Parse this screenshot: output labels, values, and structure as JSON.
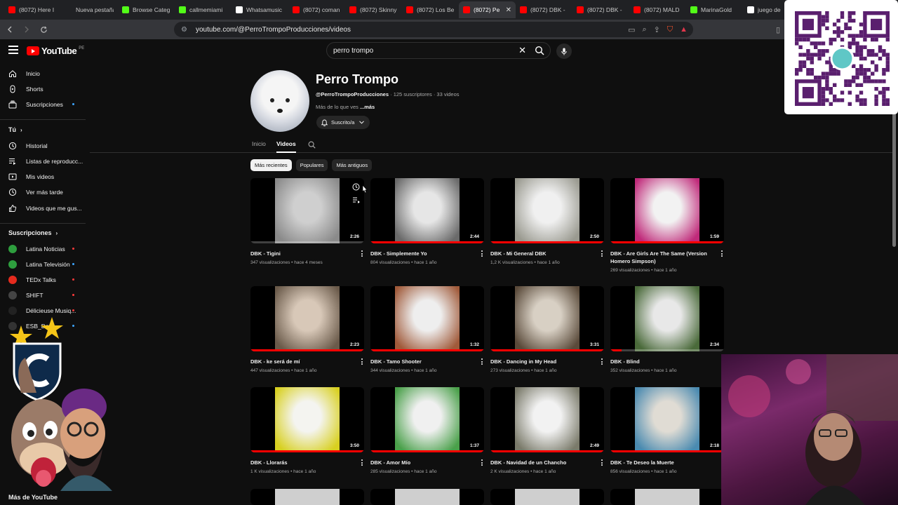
{
  "browser": {
    "tabs": [
      {
        "title": "(8072) Here I",
        "favicon": "youtube",
        "active": false
      },
      {
        "title": "Nueva pestaña",
        "favicon": "blank",
        "active": false
      },
      {
        "title": "Browse Categ",
        "favicon": "kick",
        "active": false
      },
      {
        "title": "callmemiami",
        "favicon": "kick",
        "active": false
      },
      {
        "title": "Whatsamusic",
        "favicon": "music",
        "active": false
      },
      {
        "title": "(8072) coman",
        "favicon": "youtube",
        "active": false
      },
      {
        "title": "(8072) Skinny",
        "favicon": "youtube",
        "active": false
      },
      {
        "title": "(8072) Los Be",
        "favicon": "youtube",
        "active": false
      },
      {
        "title": "(8072) Pe",
        "favicon": "youtube",
        "active": true
      },
      {
        "title": "(8072) DBK -",
        "favicon": "youtube",
        "active": false
      },
      {
        "title": "(8072) DBK -",
        "favicon": "youtube",
        "active": false
      },
      {
        "title": "(8072) MALD",
        "favicon": "youtube",
        "active": false
      },
      {
        "title": "MarinaGold",
        "favicon": "kick",
        "active": false
      },
      {
        "title": "juego de",
        "favicon": "google",
        "active": false
      }
    ],
    "close_glyph": "✕",
    "url": "youtube.com/@PerroTrompoProducciones/videos"
  },
  "youtube": {
    "logo_text": "YouTube",
    "country_code": "PE",
    "search_query": "perro trompo"
  },
  "sidebar": {
    "main": [
      {
        "label": "Inicio",
        "icon": "home-icon"
      },
      {
        "label": "Shorts",
        "icon": "shorts-icon"
      },
      {
        "label": "Suscripciones",
        "icon": "subscriptions-icon"
      }
    ],
    "you_header": "Tú",
    "you": [
      {
        "label": "Historial",
        "icon": "history-icon"
      },
      {
        "label": "Listas de reproducc...",
        "icon": "playlist-icon"
      },
      {
        "label": "Mis videos",
        "icon": "my-videos-icon"
      },
      {
        "label": "Ver más tarde",
        "icon": "watch-later-icon"
      },
      {
        "label": "Videos que me gus...",
        "icon": "like-icon"
      }
    ],
    "subs_header": "Suscripciones",
    "subs": [
      {
        "label": "Latina Noticias",
        "color": "#2e9e3e"
      },
      {
        "label": "Latina Televisión",
        "color": "#2e9e3e"
      },
      {
        "label": "TEDx Talks",
        "color": "#e62b1e"
      },
      {
        "label": "SHIFT",
        "color": "#444444"
      },
      {
        "label": "Délicieuse Musiq...",
        "color": "#222222"
      },
      {
        "label": "ESB_Dota",
        "color": "#333333"
      }
    ],
    "more_header": "Más de YouTube"
  },
  "channel": {
    "name": "Perro Trompo",
    "handle": "@PerroTrompoProducciones",
    "subscribers": "125 suscriptores",
    "video_count": "33 videos",
    "desc": "Más de lo que ves",
    "desc_more": "...más",
    "subscribed_label": "Suscrito/a",
    "tabs": [
      "Inicio",
      "Videos"
    ],
    "active_tab": "Videos",
    "chips": [
      "Más recientes",
      "Populares",
      "Más antiguos"
    ],
    "selected_chip": "Más recientes"
  },
  "videos": [
    {
      "title": "DBK - Tigini",
      "duration": "2:26",
      "views": "347 visualizaciones",
      "age": "hace 4 meses",
      "watched": 0
    },
    {
      "title": "DBK - Simplemente Yo",
      "duration": "2:44",
      "views": "804 visualizaciones",
      "age": "hace 1 año",
      "watched": 1
    },
    {
      "title": "DBK - Mi General DBK",
      "duration": "2:50",
      "views": "1,2 K visualizaciones",
      "age": "hace 1 año",
      "watched": 1
    },
    {
      "title": "DBK - Are Girls Are The Same (Version Homero Simpson)",
      "duration": "1:59",
      "views": "269 visualizaciones",
      "age": "hace 1 año",
      "watched": 1
    },
    {
      "title": "DBK - ke será de mí",
      "duration": "2:23",
      "views": "447 visualizaciones",
      "age": "hace 1 año",
      "watched": 1
    },
    {
      "title": "DBK - Tamo Shooter",
      "duration": "1:32",
      "views": "344 visualizaciones",
      "age": "hace 1 año",
      "watched": 1
    },
    {
      "title": "DBK - Dancing in My Head",
      "duration": "3:31",
      "views": "273 visualizaciones",
      "age": "hace 1 año",
      "watched": 1
    },
    {
      "title": "DBK - Blind",
      "duration": "2:34",
      "views": "352 visualizaciones",
      "age": "hace 1 año",
      "watched": 0.1
    },
    {
      "title": "DBK - Llorarás",
      "duration": "3:50",
      "views": "1 K visualizaciones",
      "age": "hace 1 año",
      "watched": 1
    },
    {
      "title": "DBK - Amor Mío",
      "duration": "1:37",
      "views": "285 visualizaciones",
      "age": "hace 1 año",
      "watched": 1
    },
    {
      "title": "DBK - Navidad de un Chancho",
      "duration": "2:49",
      "views": "2 K visualizaciones",
      "age": "hace 1 año",
      "watched": 1
    },
    {
      "title": "DBK - Te Deseo la Muerte",
      "duration": "2:18",
      "views": "856 visualizaciones",
      "age": "hace 1 año",
      "watched": 1
    }
  ],
  "colors": {
    "accent": "#ff0000",
    "background": "#0f0f0f",
    "link": "#3ea6ff"
  }
}
